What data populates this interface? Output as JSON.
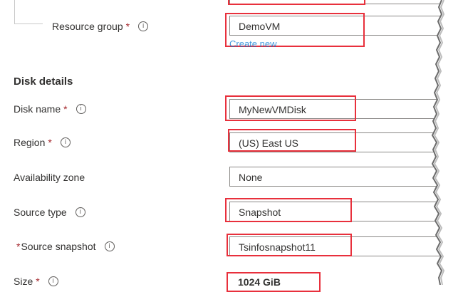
{
  "resource_group": {
    "label": "Resource group",
    "required_mark": "*",
    "value": "DemoVM",
    "create_new_link": "Create new"
  },
  "disk_details": {
    "title": "Disk details",
    "fields": {
      "disk_name": {
        "label": "Disk name",
        "required_mark": "*",
        "value": "MyNewVMDisk"
      },
      "region": {
        "label": "Region",
        "required_mark": "*",
        "value": "(US) East US"
      },
      "availability_zone": {
        "label": "Availability zone",
        "value": "None"
      },
      "source_type": {
        "label": "Source type",
        "value": "Snapshot"
      },
      "source_snapshot": {
        "label": "Source snapshot",
        "required_mark": "*",
        "value": "Tsinfosnapshot11"
      },
      "size": {
        "label": "Size",
        "required_mark": "*",
        "value": "1024 GiB"
      }
    }
  },
  "icons": {
    "info": "info-icon"
  },
  "colors": {
    "highlight": "#e8303c",
    "link": "#0078d4",
    "required": "#a4262c"
  }
}
